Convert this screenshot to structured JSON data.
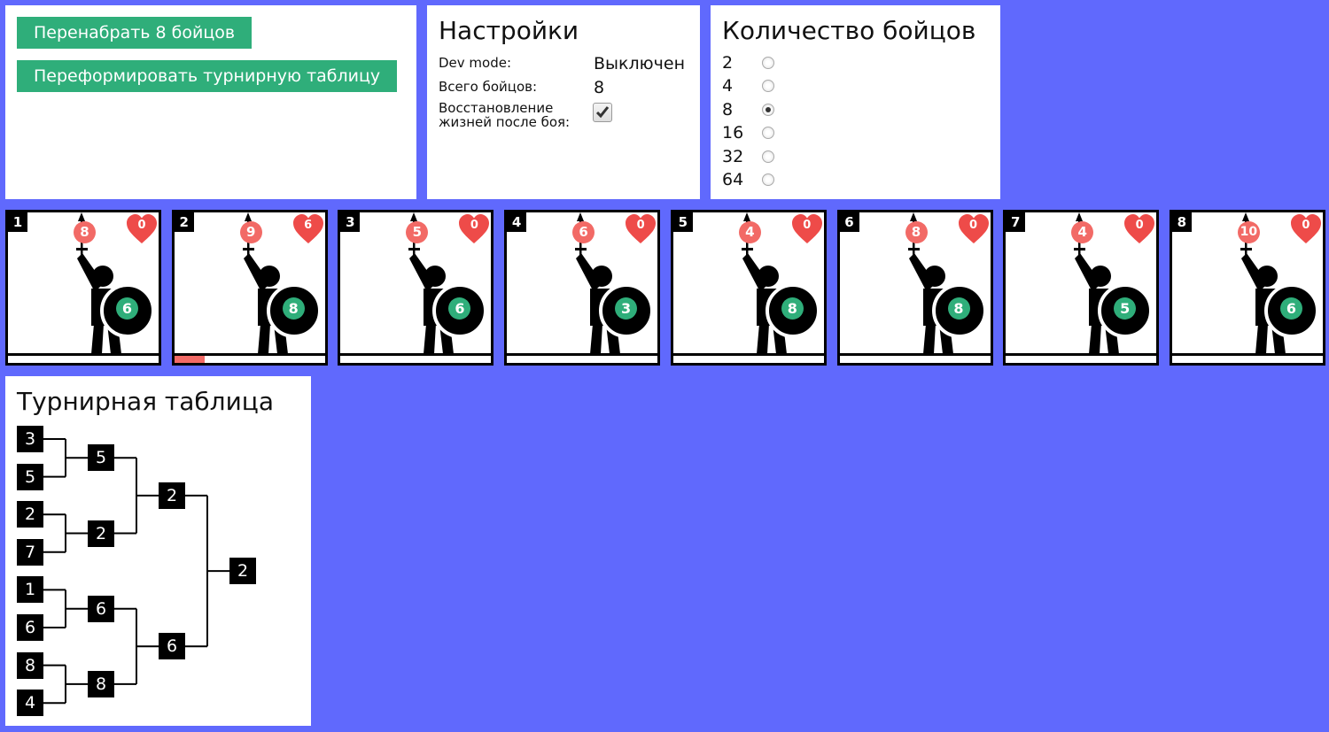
{
  "actions": {
    "reroll_label": "Перенабрать 8 бойцов",
    "reform_label": "Переформировать турнирную таблицу"
  },
  "settings": {
    "title": "Настройки",
    "dev_mode_label": "Dev mode:",
    "dev_mode_value": "Выключен",
    "total_label": "Всего бойцов:",
    "total_value": "8",
    "restore_label_1": "Восстановление",
    "restore_label_2": "жизней после боя:",
    "restore_checked": true
  },
  "count": {
    "title": "Количество бойцов",
    "options": [
      "2",
      "4",
      "8",
      "16",
      "32",
      "64"
    ],
    "selected": "8"
  },
  "fighters": [
    {
      "num": "1",
      "attack": "8",
      "defense": "6",
      "hearts": "0",
      "health": 0
    },
    {
      "num": "2",
      "attack": "9",
      "defense": "8",
      "hearts": "6",
      "health": 0.2
    },
    {
      "num": "3",
      "attack": "5",
      "defense": "6",
      "hearts": "0",
      "health": 0
    },
    {
      "num": "4",
      "attack": "6",
      "defense": "3",
      "hearts": "0",
      "health": 0
    },
    {
      "num": "5",
      "attack": "4",
      "defense": "8",
      "hearts": "0",
      "health": 0
    },
    {
      "num": "6",
      "attack": "8",
      "defense": "8",
      "hearts": "0",
      "health": 0
    },
    {
      "num": "7",
      "attack": "4",
      "defense": "5",
      "hearts": "0",
      "health": 0
    },
    {
      "num": "8",
      "attack": "10",
      "defense": "6",
      "hearts": "0",
      "health": 0
    }
  ],
  "colors": {
    "background": "#6069fd",
    "button": "#2fae7a",
    "attack": "#f26a66",
    "defense": "#2fae7a",
    "heart": "#ee4b49"
  },
  "bracket": {
    "title": "Турнирная таблица",
    "rounds": [
      [
        "3",
        "5",
        "2",
        "7",
        "1",
        "6",
        "8",
        "4"
      ],
      [
        "5",
        "2",
        "6",
        "8"
      ],
      [
        "2",
        "6"
      ],
      [
        "2"
      ]
    ]
  }
}
